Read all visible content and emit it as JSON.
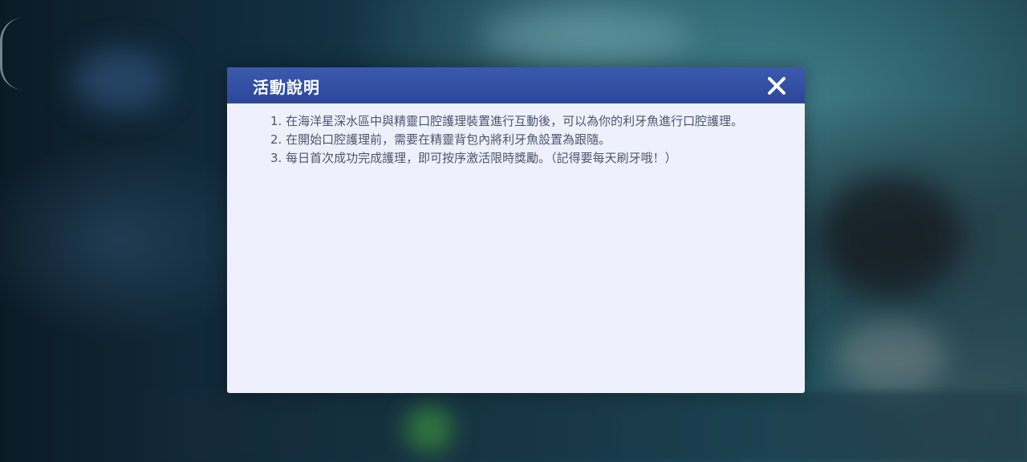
{
  "dialog": {
    "title": "活動說明",
    "close_icon": "close-icon",
    "rules": [
      "1. 在海洋星深水區中與精靈口腔護理裝置進行互動後，可以為你的利牙魚進行口腔護理。",
      "2. 在開始口腔護理前，需要在精靈背包內將利牙魚設置為跟隨。",
      "3. 每日首次成功完成護理，即可按序激活限時獎勵。（記得要每天刷牙哦！）"
    ],
    "watermark_icon": "carvanha-silhouette-icon"
  },
  "colors": {
    "header": "#2d479a",
    "panel": "#eef1fb",
    "text": "#4d5570",
    "title": "#ffffff"
  }
}
